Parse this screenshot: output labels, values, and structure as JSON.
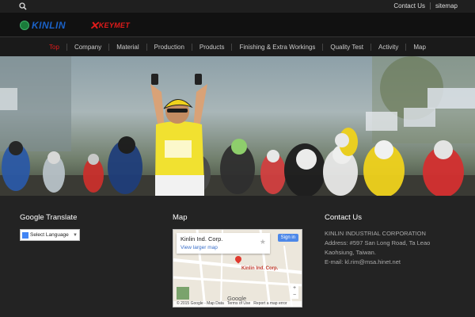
{
  "topbar": {
    "links": [
      "Contact Us",
      "sitemap"
    ]
  },
  "brand": {
    "kinlin": "KINLIN",
    "keymet": "KEYMET"
  },
  "nav": {
    "items": [
      "Top",
      "Company",
      "Material",
      "Production",
      "Products",
      "Finishing & Extra Workings",
      "Quality Test",
      "Activity",
      "Map"
    ],
    "active": "Top"
  },
  "footer": {
    "translate": {
      "title": "Google Translate",
      "select": "Select Language"
    },
    "map": {
      "title": "Map",
      "place": "Kinlin Ind. Corp.",
      "larger": "View larger map",
      "signin": "Sign in",
      "pin_label": "Kinlin Ind. Corp.",
      "copyright": "© 2015 Google - Map Data",
      "terms": "Terms of Use",
      "report": "Report a map error",
      "google": "Google"
    },
    "contact": {
      "title": "Contact Us",
      "lines": [
        "KINLIN INDUSTRIAL CORPORATION",
        "Address: #597 San Long Road, Ta Leao",
        "Kaohsiung, Taiwan.",
        "E-mail: kl.rim@msa.hinet.net"
      ]
    }
  },
  "colors": {
    "accent": "#e21b1b",
    "brand_blue": "#1b62c8"
  }
}
